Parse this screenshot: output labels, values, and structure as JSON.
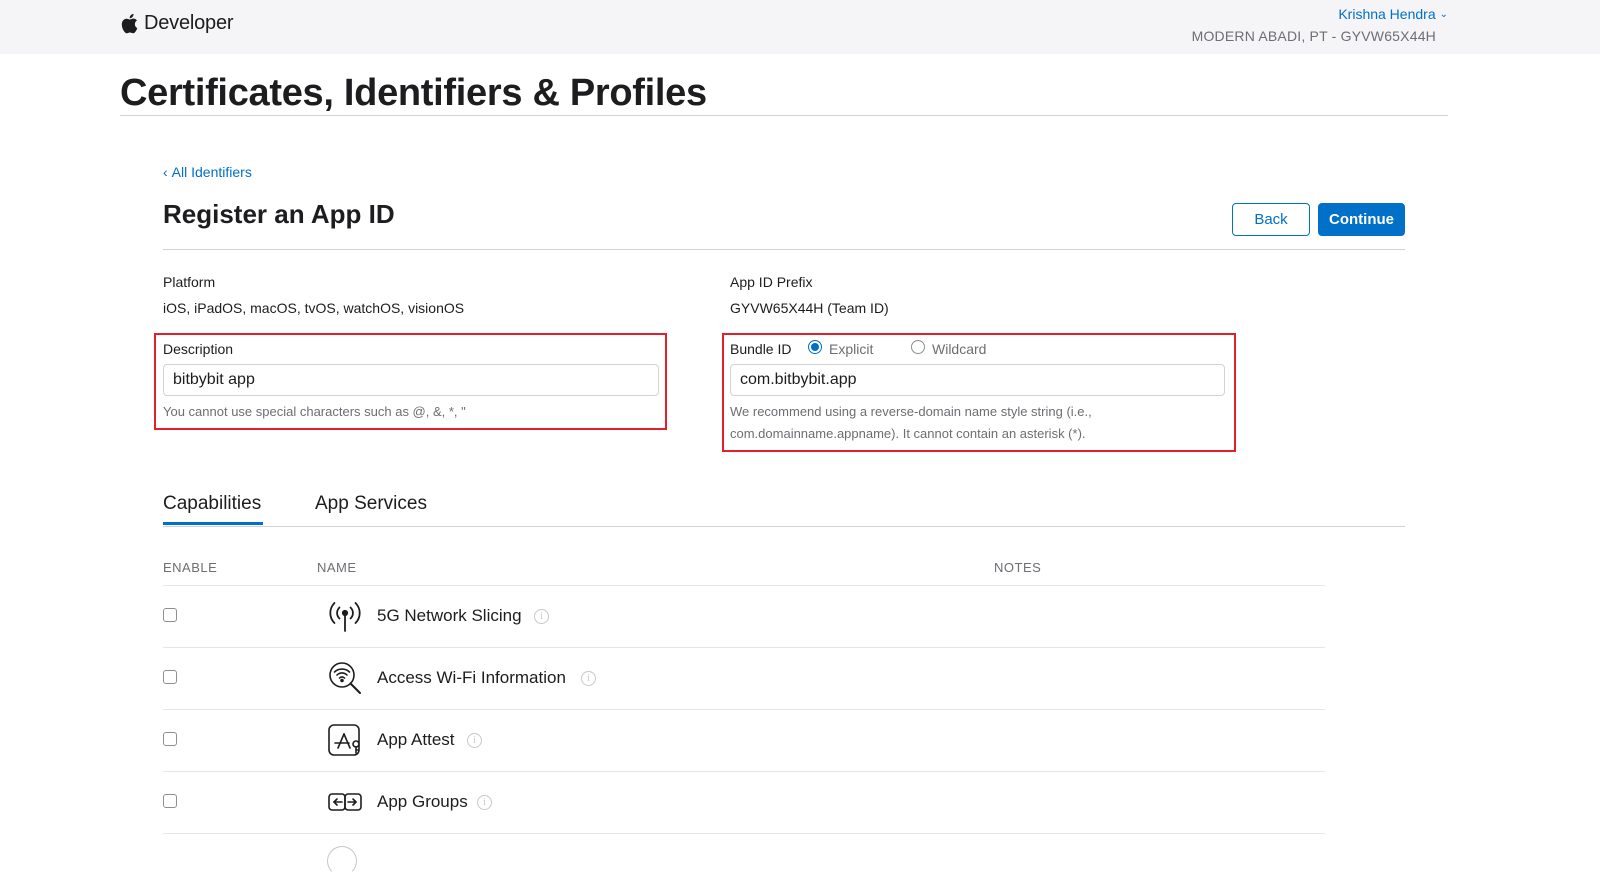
{
  "header": {
    "brand": "Developer",
    "user_name": "Krishna Hendra",
    "team": "MODERN ABADI, PT - GYVW65X44H"
  },
  "page": {
    "title": "Certificates, Identifiers & Profiles",
    "back_link": "All Identifiers",
    "section_title": "Register an App ID",
    "back_button": "Back",
    "continue_button": "Continue"
  },
  "form": {
    "platform_label": "Platform",
    "platform_value": "iOS, iPadOS, macOS, tvOS, watchOS, visionOS",
    "prefix_label": "App ID Prefix",
    "prefix_value": "GYVW65X44H (Team ID)",
    "description_label": "Description",
    "description_value": "bitbybit app",
    "description_hint": "You cannot use special characters such as @, &, *, \"",
    "bundle_label": "Bundle ID",
    "bundle_option_explicit": "Explicit",
    "bundle_option_wildcard": "Wildcard",
    "bundle_selected": "Explicit",
    "bundle_value": "com.bitbybit.app",
    "bundle_hint_line1": "We recommend using a reverse-domain name style string (i.e.,",
    "bundle_hint_line2": "com.domainname.appname). It cannot contain an asterisk (*)."
  },
  "tabs": [
    {
      "label": "Capabilities",
      "active": true
    },
    {
      "label": "App Services",
      "active": false
    }
  ],
  "table": {
    "headers": {
      "enable": "ENABLE",
      "name": "NAME",
      "notes": "NOTES"
    },
    "rows": [
      {
        "name": "5G Network Slicing",
        "icon": "antenna-icon",
        "enabled": false
      },
      {
        "name": "Access Wi-Fi Information",
        "icon": "wifi-search-icon",
        "enabled": false
      },
      {
        "name": "App Attest",
        "icon": "app-attest-icon",
        "enabled": false
      },
      {
        "name": "App Groups",
        "icon": "app-groups-icon",
        "enabled": false
      }
    ]
  },
  "colors": {
    "accent": "#0070c9",
    "highlight": "#e0202a"
  }
}
